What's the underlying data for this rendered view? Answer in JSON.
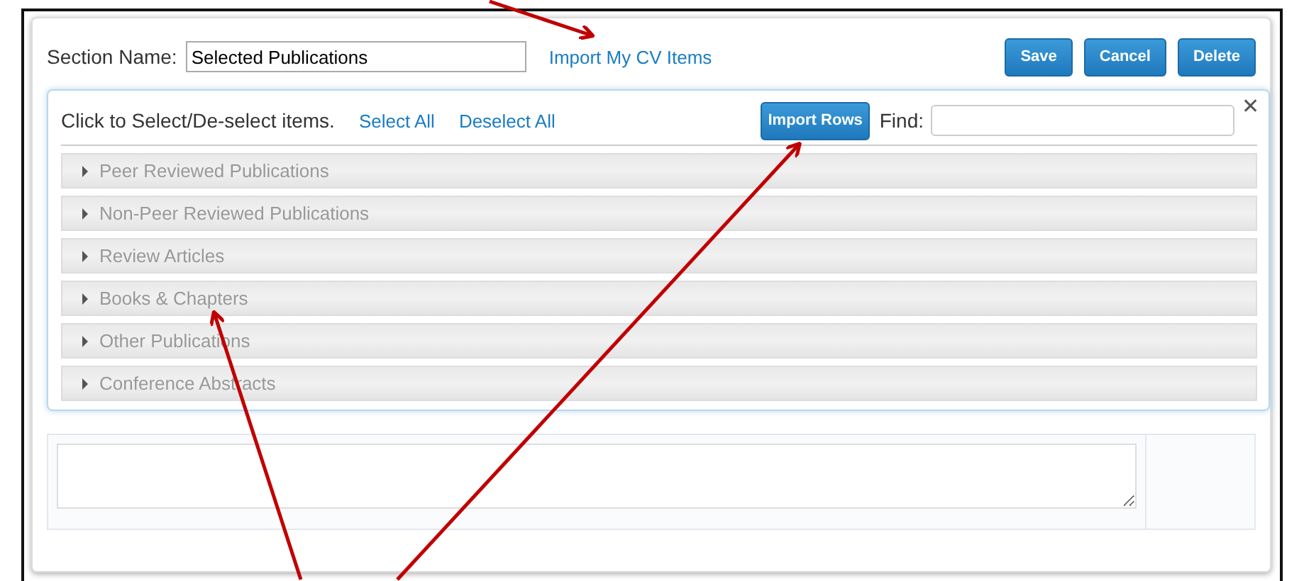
{
  "section_name": {
    "label": "Section Name:",
    "value": "Selected Publications"
  },
  "import_link": "Import My CV Items",
  "buttons": [
    "Save",
    "Cancel",
    "Delete"
  ],
  "panel": {
    "instruction": "Click to Select/De-select items.",
    "links": [
      "Select All",
      "Deselect All"
    ],
    "import_button": "Import Rows",
    "find": {
      "label": "Find:"
    },
    "close": "✕",
    "groups": [
      {
        "label": "Peer Reviewed Publications",
        "expanded": false
      },
      {
        "label": "Non-Peer Reviewed Publications",
        "expanded": false
      },
      {
        "label": "Review Articles",
        "expanded": false
      },
      {
        "label": "Books & Chapters",
        "expanded": false
      },
      {
        "label": "Other Publications",
        "expanded": false
      },
      {
        "label": "Conference Abstracts",
        "expanded": false
      }
    ]
  }
}
